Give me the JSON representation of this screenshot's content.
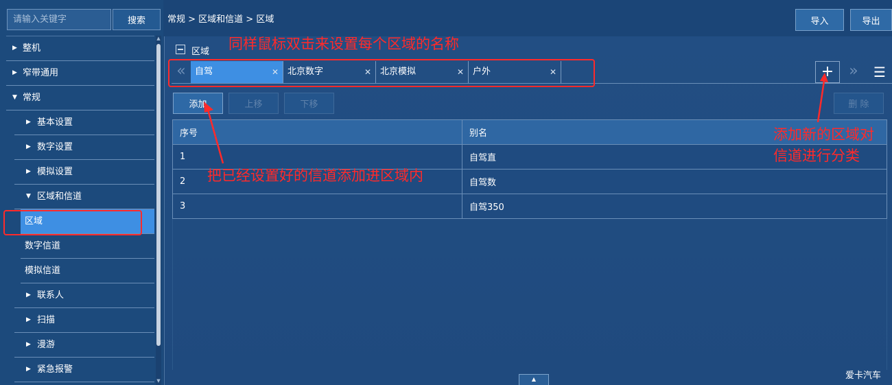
{
  "search": {
    "placeholder": "请输入关键字",
    "button_label": "搜索"
  },
  "sidebar": {
    "items": [
      {
        "label": "整机",
        "expanded": false
      },
      {
        "label": "窄带通用",
        "expanded": false
      },
      {
        "label": "常规",
        "expanded": true
      },
      {
        "label": "基本设置",
        "expanded": false
      },
      {
        "label": "数字设置",
        "expanded": false
      },
      {
        "label": "模拟设置",
        "expanded": false
      },
      {
        "label": "区域和信道",
        "expanded": true
      },
      {
        "label": "区域",
        "selected": true
      },
      {
        "label": "数字信道"
      },
      {
        "label": "模拟信道"
      },
      {
        "label": "联系人",
        "expanded": false
      },
      {
        "label": "扫描",
        "expanded": false
      },
      {
        "label": "漫游",
        "expanded": false
      },
      {
        "label": "紧急报警",
        "expanded": false
      }
    ]
  },
  "breadcrumb": "常规 > 区域和信道 > 区域",
  "header": {
    "import_label": "导入",
    "export_label": "导出"
  },
  "section": {
    "title": "区域"
  },
  "tabs": [
    {
      "label": "自驾",
      "active": true
    },
    {
      "label": "北京数字"
    },
    {
      "label": "北京模拟"
    },
    {
      "label": "户外"
    }
  ],
  "toolbar": {
    "add_label": "添加",
    "up_label": "上移",
    "down_label": "下移",
    "delete_label": "删 除"
  },
  "table": {
    "columns": [
      "序号",
      "别名"
    ],
    "rows": [
      [
        "1",
        "自驾直"
      ],
      [
        "2",
        "自驾数"
      ],
      [
        "3",
        "自驾350"
      ]
    ]
  },
  "annotations": {
    "top": "同样鼠标双击来设置每个区域的名称",
    "add": "把已经设置好的信道添加进区域内",
    "right_line1": "添加新的区域对",
    "right_line2": "信道进行分类"
  },
  "watermark": "爱卡汽车",
  "colors": {
    "accent": "#3e8fe3",
    "background": "#1b4577",
    "annotation": "#ff2a2a"
  }
}
